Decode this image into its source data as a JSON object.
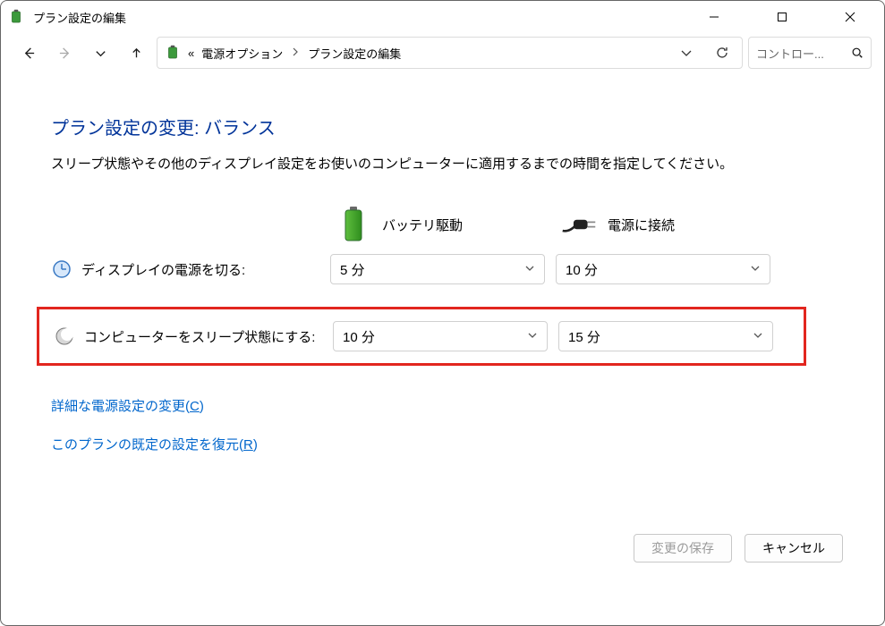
{
  "window": {
    "title": "プラン設定の編集"
  },
  "breadcrumb": {
    "prefix": "«",
    "item1": "電源オプション",
    "item2": "プラン設定の編集"
  },
  "search": {
    "placeholder": "コントロー..."
  },
  "main": {
    "heading": "プラン設定の変更: バランス",
    "description": "スリープ状態やその他のディスプレイ設定をお使いのコンピューターに適用するまでの時間を指定してください。",
    "columns": {
      "battery": "バッテリ駆動",
      "plugged": "電源に接続"
    },
    "rows": {
      "display": {
        "label": "ディスプレイの電源を切る:",
        "battery": "5 分",
        "plugged": "10 分"
      },
      "sleep": {
        "label": "コンピューターをスリープ状態にする:",
        "battery": "10 分",
        "plugged": "15 分"
      }
    },
    "links": {
      "advanced_prefix": "詳細な電源設定の変更(",
      "advanced_accel": "C",
      "advanced_suffix": ")",
      "restore_prefix": "このプランの既定の設定を復元(",
      "restore_accel": "R",
      "restore_suffix": ")"
    },
    "buttons": {
      "save": "変更の保存",
      "cancel": "キャンセル"
    }
  }
}
